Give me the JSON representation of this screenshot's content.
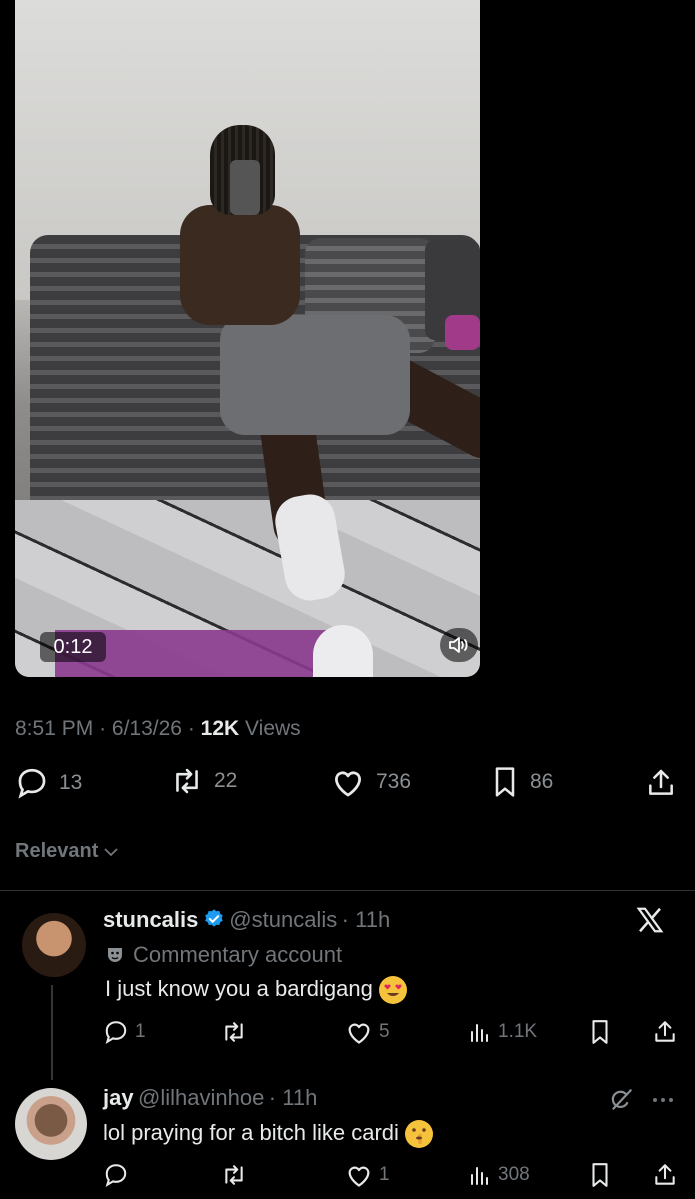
{
  "video": {
    "duration": "0:12",
    "icons": {
      "volume": "volume-icon"
    }
  },
  "post": {
    "time": "8:51 PM",
    "date": "6/13/26",
    "views_count": "12K",
    "views_label": "Views",
    "separator": "·"
  },
  "post_actions": {
    "replies": "13",
    "reposts": "22",
    "likes": "736",
    "bookmarks": "86",
    "icons": [
      "reply-icon",
      "repost-icon",
      "like-icon",
      "bookmark-icon",
      "share-icon"
    ]
  },
  "sort": {
    "label": "Relevant"
  },
  "replies": [
    {
      "display_name": "stuncalis",
      "handle": "@stuncalis",
      "time": "11h",
      "verified": true,
      "badge_text": "Commentary account",
      "text": "I just know you a bardigang",
      "emoji": "heart-eyes-emoji",
      "replies": "1",
      "reposts": "",
      "likes": "5",
      "views": "1.1K"
    },
    {
      "display_name": "jay",
      "handle": "@lilhavinhoe",
      "time": "11h",
      "verified": false,
      "text": "lol praying for a bitch like cardi",
      "emoji": "shushing-face-emoji",
      "replies": "",
      "reposts": "",
      "likes": "1",
      "views": "308"
    }
  ],
  "colors": {
    "background": "#000000",
    "text": "#e7e9ea",
    "muted": "#71767b",
    "verified": "#1d9bf0"
  }
}
